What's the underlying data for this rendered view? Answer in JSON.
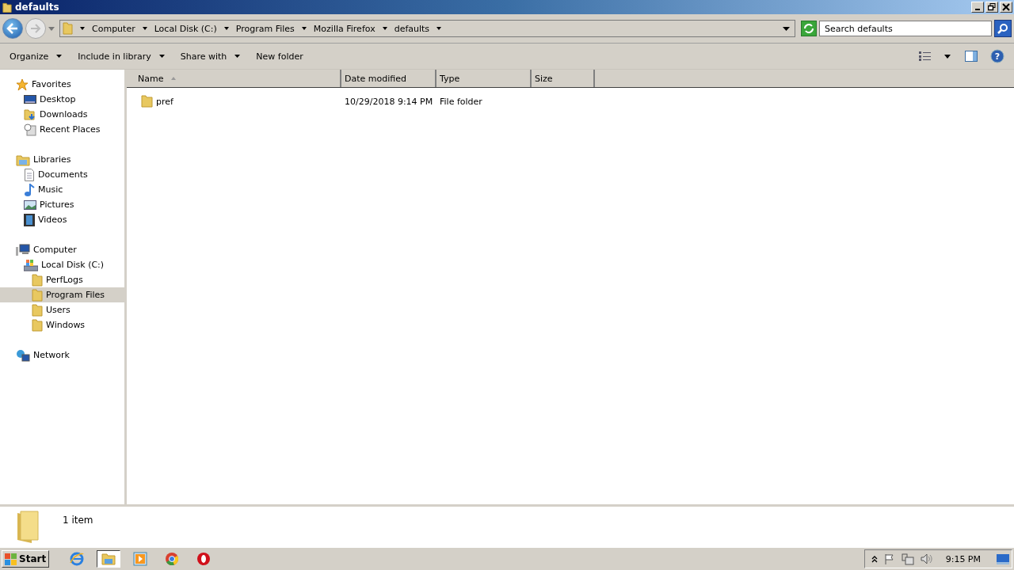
{
  "window": {
    "title": "defaults"
  },
  "address": {
    "crumbs": [
      "Computer",
      "Local Disk (C:)",
      "Program Files",
      "Mozilla Firefox",
      "defaults"
    ]
  },
  "search": {
    "placeholder": "Search defaults"
  },
  "toolbar": {
    "menus": [
      "Organize",
      "Include in library",
      "Share with"
    ],
    "buttons": [
      "New folder"
    ],
    "help": "?"
  },
  "sidebar": {
    "groups": [
      {
        "label": "Favorites",
        "kind": "star",
        "selected": false,
        "children": [
          {
            "label": "Desktop",
            "kind": "desktop",
            "selected": false
          },
          {
            "label": "Downloads",
            "kind": "download",
            "selected": false
          },
          {
            "label": "Recent Places",
            "kind": "recent",
            "selected": false
          }
        ]
      },
      {
        "label": "Libraries",
        "kind": "library",
        "selected": false,
        "children": [
          {
            "label": "Documents",
            "kind": "document",
            "selected": false
          },
          {
            "label": "Music",
            "kind": "music",
            "selected": false
          },
          {
            "label": "Pictures",
            "kind": "picture",
            "selected": false
          },
          {
            "label": "Videos",
            "kind": "video",
            "selected": false
          }
        ]
      },
      {
        "label": "Computer",
        "kind": "computer",
        "selected": false,
        "children": [
          {
            "label": "Local Disk (C:)",
            "kind": "disk",
            "selected": false,
            "children": [
              {
                "label": "PerfLogs",
                "kind": "folder",
                "selected": false
              },
              {
                "label": "Program Files",
                "kind": "folder",
                "selected": true
              },
              {
                "label": "Users",
                "kind": "folder",
                "selected": false
              },
              {
                "label": "Windows",
                "kind": "folder",
                "selected": false
              }
            ]
          }
        ]
      },
      {
        "label": "Network",
        "kind": "network",
        "selected": false
      }
    ]
  },
  "table": {
    "columns": [
      "Name",
      "Date modified",
      "Type",
      "Size"
    ],
    "rows": [
      {
        "name": "pref",
        "date_modified": "10/29/2018 9:14 PM",
        "type": "File folder"
      }
    ]
  },
  "details": {
    "text": "1 item"
  },
  "taskbar": {
    "start": "Start",
    "apps": [
      {
        "kind": "ie",
        "selected": false
      },
      {
        "kind": "explorer",
        "selected": true
      },
      {
        "kind": "media",
        "selected": false
      },
      {
        "kind": "chrome",
        "selected": false
      },
      {
        "kind": "opera",
        "selected": false
      }
    ],
    "clock": "9:15 PM"
  }
}
